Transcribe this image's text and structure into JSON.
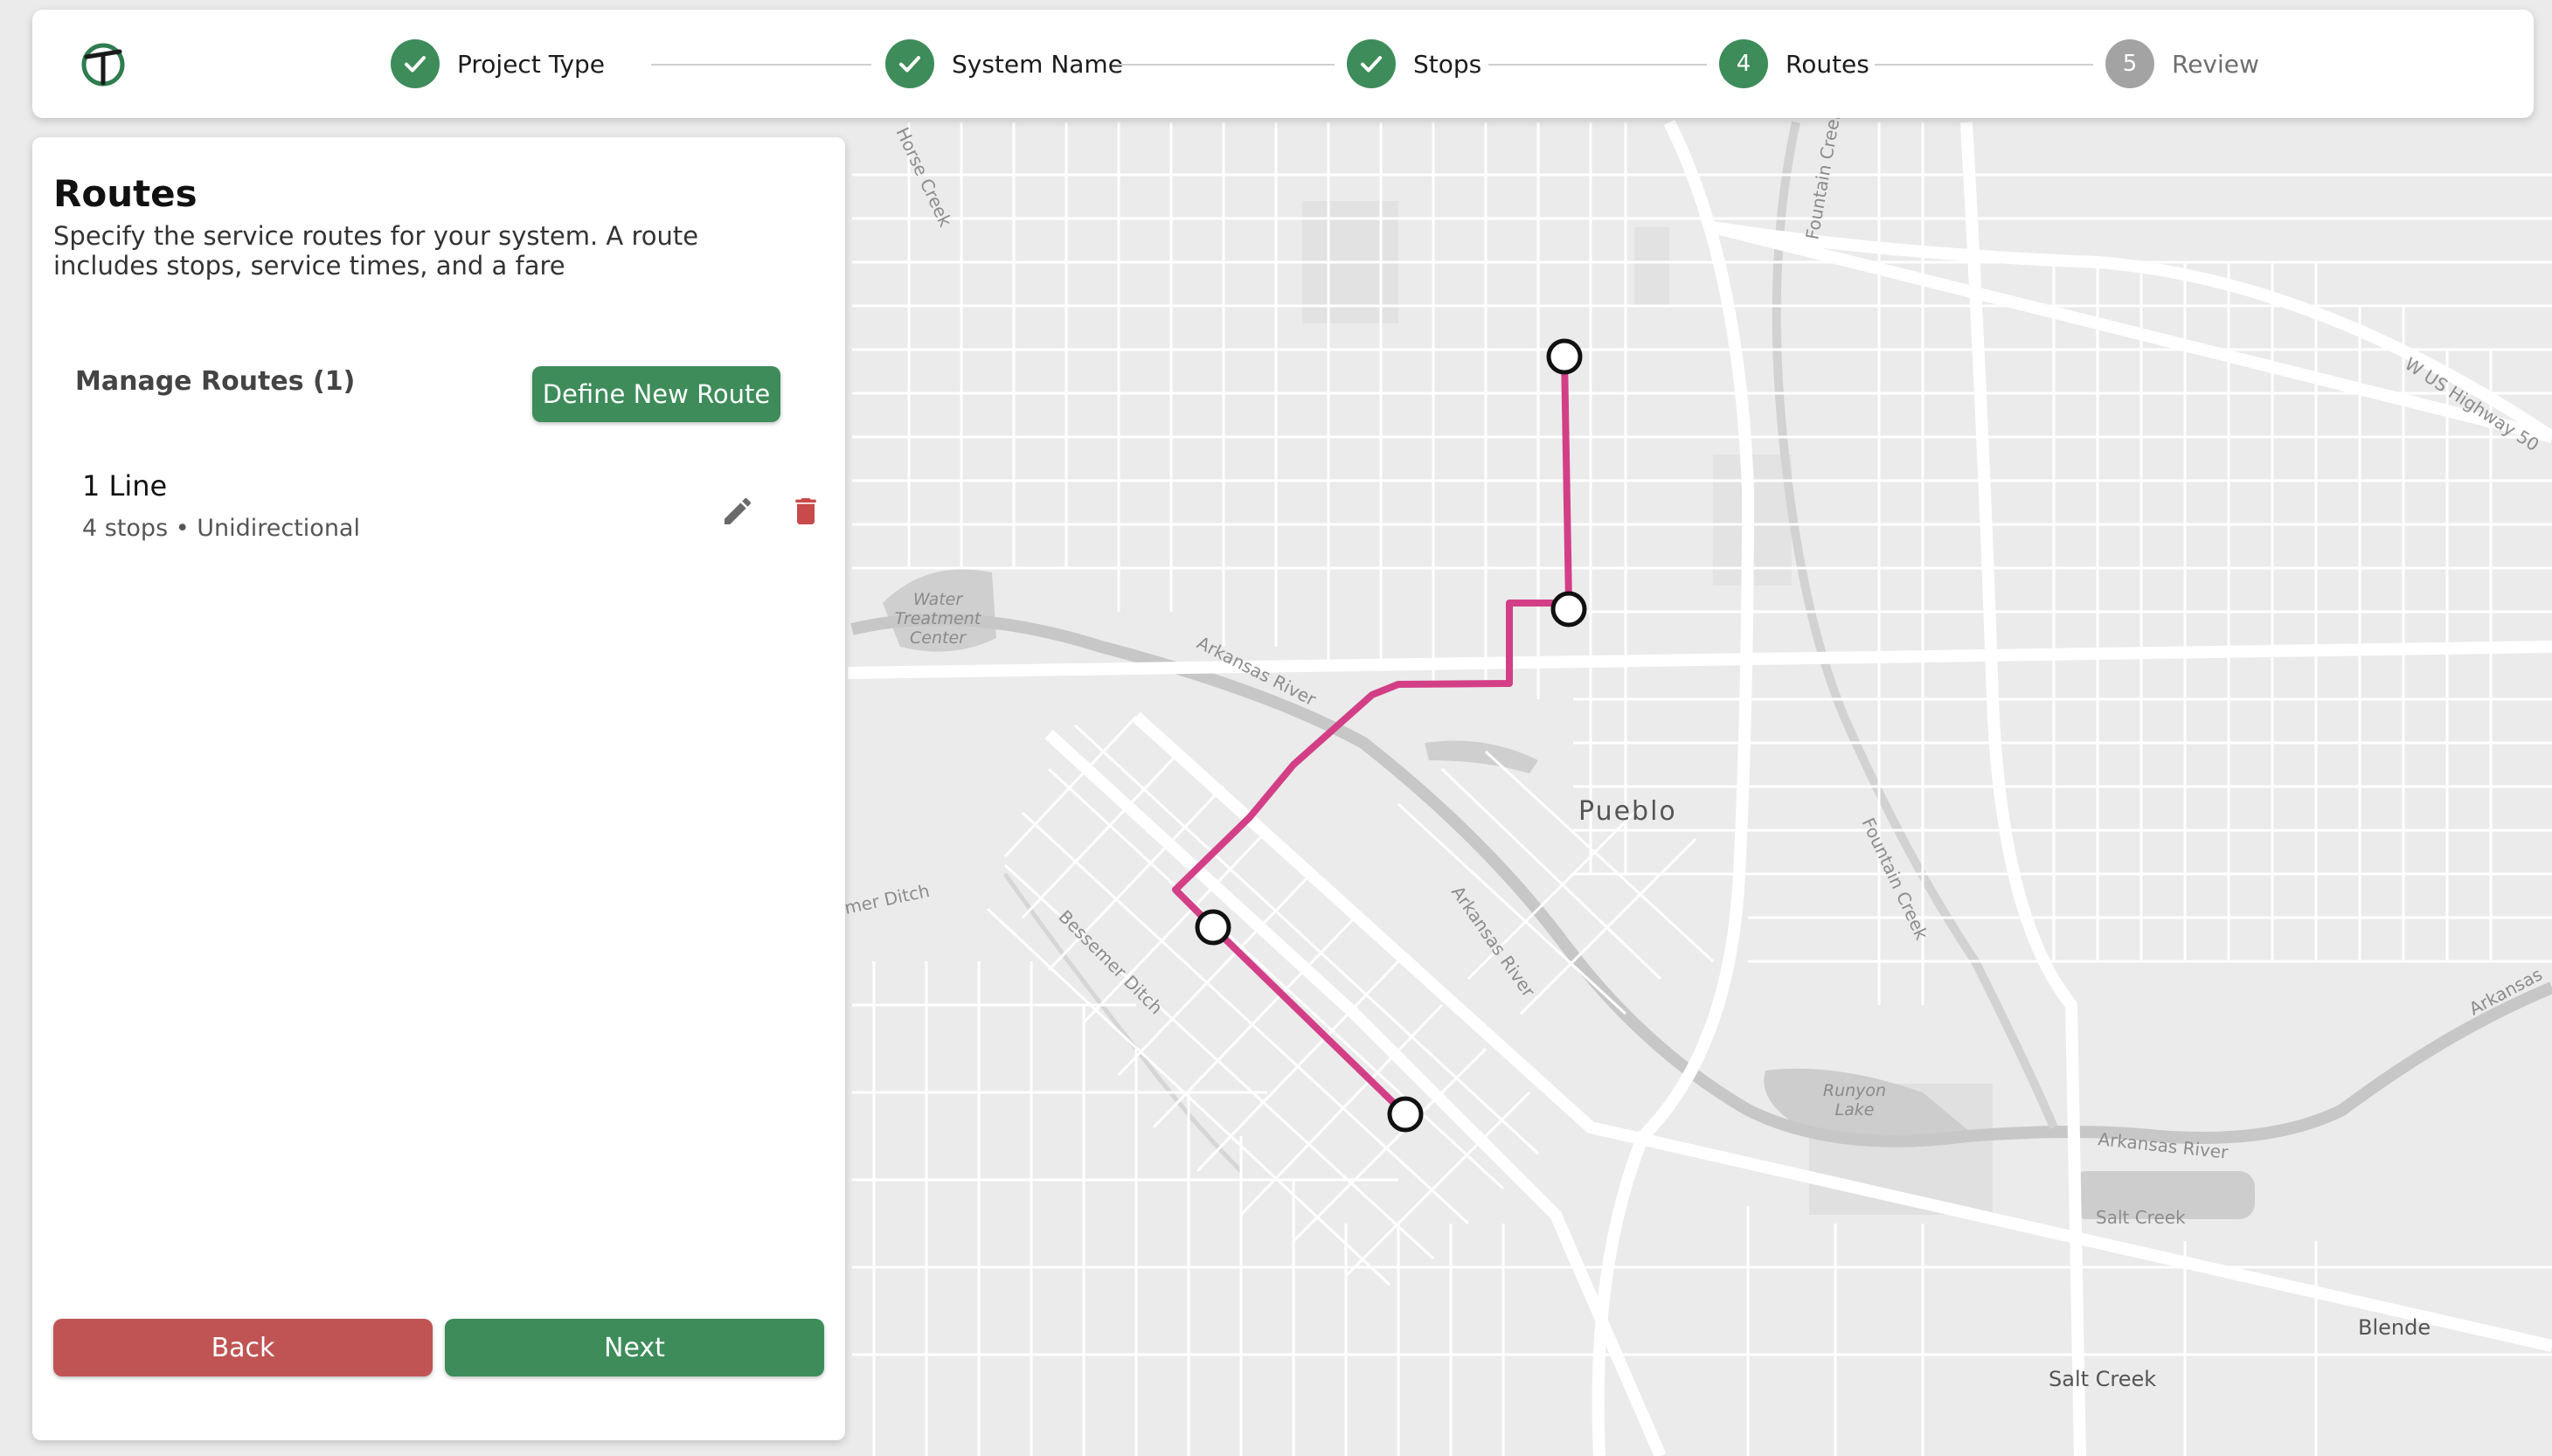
{
  "stepper": {
    "steps": [
      {
        "label": "Project Type",
        "status": "complete",
        "icon": "check-icon"
      },
      {
        "label": "System Name",
        "status": "complete",
        "icon": "check-icon"
      },
      {
        "label": "Stops",
        "status": "complete",
        "icon": "check-icon"
      },
      {
        "label": "Routes",
        "status": "active",
        "number": "4"
      },
      {
        "label": "Review",
        "status": "pending",
        "number": "5"
      }
    ]
  },
  "panel": {
    "title": "Routes",
    "description": "Specify the service routes for your system. A route includes stops, service times, and a fare",
    "manage_title": "Manage Routes (1)",
    "define_button": "Define New Route",
    "routes": [
      {
        "name": "1 Line",
        "meta": "4 stops • Unidirectional"
      }
    ],
    "back_button": "Back",
    "next_button": "Next"
  },
  "map": {
    "labels": {
      "city": "Pueblo",
      "river_1": "Arkansas River",
      "river_2": "Arkansas River",
      "river_3": "Arkansas River",
      "river_4": "Arkansas",
      "fountain_creek_1": "Fountain Creek",
      "fountain_creek_2": "Fountain Creek",
      "horse_creek": "Horse Creek",
      "bessemer_ditch_1": "Bessemer Ditch",
      "bessemer_ditch_2": "mer Ditch",
      "water_treatment_1": "Water",
      "water_treatment_2": "Treatment",
      "water_treatment_3": "Center",
      "runyon_1": "Runyon",
      "runyon_2": "Lake",
      "salt_creek_small": "Salt Creek",
      "salt_creek": "Salt Creek",
      "blende": "Blende",
      "highway": "W US Highway 50"
    },
    "route_color": "#d33f87"
  },
  "colors": {
    "primary": "#3d8c5a",
    "danger": "#c05454",
    "pending": "#a3a3a3"
  }
}
